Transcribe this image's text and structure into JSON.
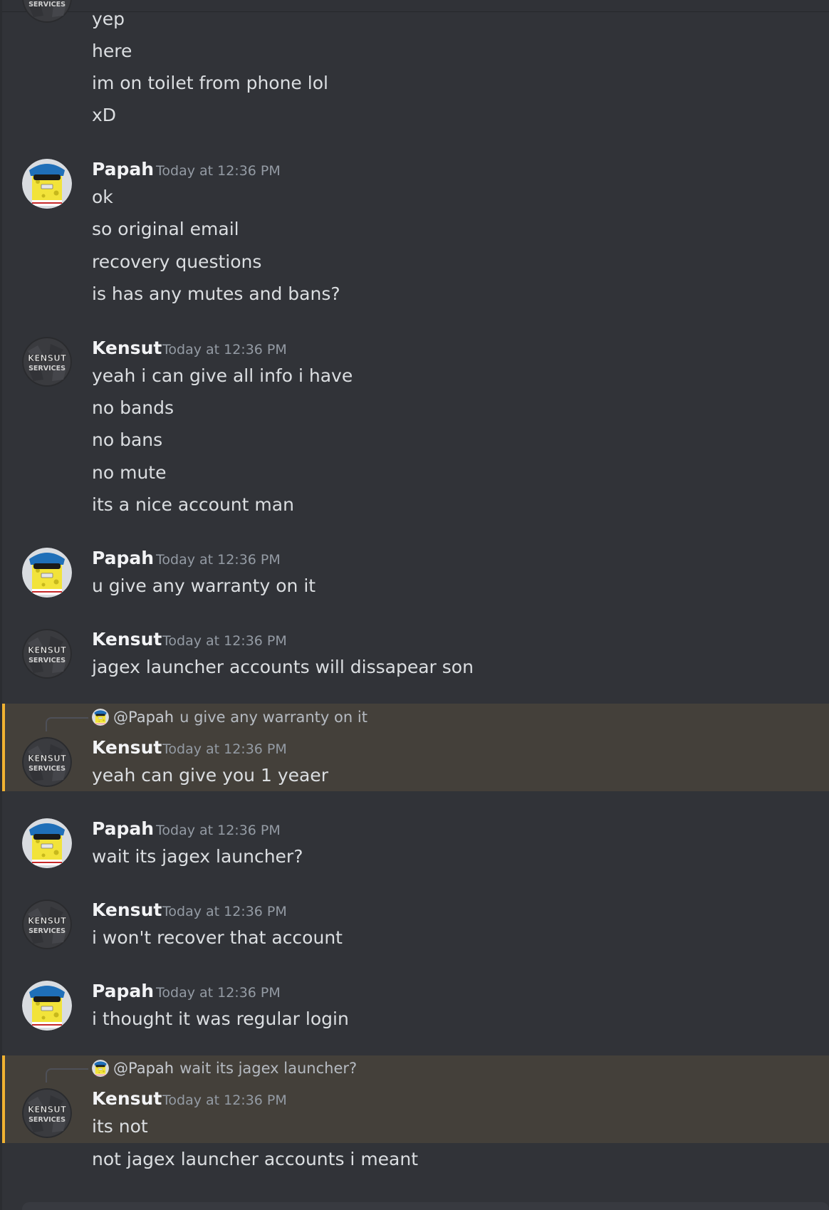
{
  "channel": {
    "messages": [
      {
        "lines": [
          "yep",
          "here",
          "im on toilet from phone lol",
          "xD"
        ]
      },
      {
        "author": "Papah",
        "timestamp": "Today at 12:36 PM",
        "lines": [
          "ok",
          "so original email",
          "recovery questions",
          "is has any mutes and bans?"
        ]
      },
      {
        "author": "Kensut",
        "timestamp": "Today at 12:36 PM",
        "lines": [
          "yeah i can give all info i have",
          "no bands",
          "no bans",
          "no mute",
          "its a nice account man"
        ]
      },
      {
        "author": "Papah",
        "timestamp": "Today at 12:36 PM",
        "lines": [
          "u give any warranty on it"
        ]
      },
      {
        "author": "Kensut",
        "timestamp": "Today at 12:36 PM",
        "lines": [
          "jagex launcher accounts will dissapear son"
        ]
      },
      {
        "author": "Kensut",
        "timestamp": "Today at 12:36 PM",
        "reply": {
          "to": "@Papah",
          "text": "u give any warranty on it"
        },
        "lines": [
          "yeah can give you 1 yeaer"
        ]
      },
      {
        "author": "Papah",
        "timestamp": "Today at 12:36 PM",
        "lines": [
          "wait its jagex launcher?"
        ]
      },
      {
        "author": "Kensut",
        "timestamp": "Today at 12:36 PM",
        "lines": [
          "i won't recover that account"
        ]
      },
      {
        "author": "Papah",
        "timestamp": "Today at 12:36 PM",
        "lines": [
          "i thought it was regular login"
        ]
      },
      {
        "author": "Kensut",
        "timestamp": "Today at 12:36 PM",
        "reply": {
          "to": "@Papah",
          "text": "wait its jagex launcher?"
        },
        "lines": [
          "its not",
          "not jagex launcher accounts i meant"
        ]
      }
    ]
  },
  "avatars": {
    "kensut_logo_line1": "KENSUT",
    "kensut_logo_line2": "SERVICES",
    "papah_icon": "spongebob-avatar"
  },
  "colors": {
    "background": "#313338",
    "mention_highlight": "#44403a",
    "mention_bar": "#f0b232",
    "author": "#f2f3f5",
    "timestamp": "#949ba4",
    "text": "#dbdee1"
  }
}
